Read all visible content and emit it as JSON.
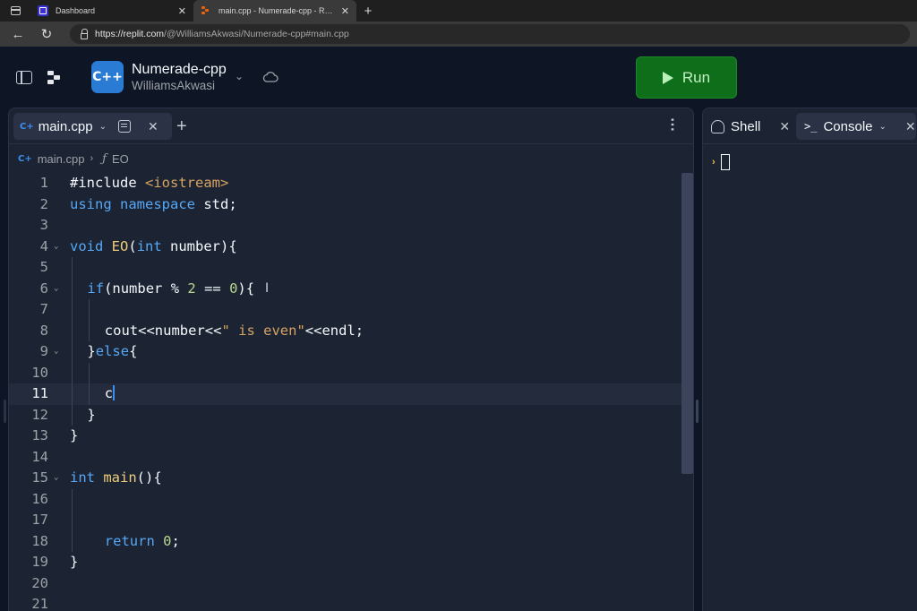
{
  "browser": {
    "tabs": [
      {
        "title": "Dashboard",
        "favicon": "dashboard-icon",
        "active": false
      },
      {
        "title": "main.cpp - Numerade-cpp - Replit",
        "favicon": "replit-icon",
        "active": true
      }
    ],
    "new_tab": "+",
    "url_host": "https://replit.com",
    "url_path": "/@WilliamsAkwasi/Numerade-cpp#main.cpp"
  },
  "header": {
    "project_name": "Numerade-cpp",
    "owner": "WilliamsAkwasi",
    "project_icon_text": "C++",
    "run_label": "Run",
    "run_color": "#0f6e1a"
  },
  "editor": {
    "tab_label": "main.cpp",
    "breadcrumb_file": "main.cpp",
    "breadcrumb_symbol": "EO",
    "breadcrumb_symbol_icon": "ƒ",
    "current_line": 11,
    "lines": [
      {
        "n": "1",
        "text": "#include <iostream>"
      },
      {
        "n": "2",
        "text": "using namespace std;"
      },
      {
        "n": "3",
        "text": ""
      },
      {
        "n": "4",
        "text": "void EO(int number){"
      },
      {
        "n": "5",
        "text": ""
      },
      {
        "n": "6",
        "text": "  if(number % 2 == 0){"
      },
      {
        "n": "7",
        "text": ""
      },
      {
        "n": "8",
        "text": "    cout<<number<<\" is even\"<<endl;"
      },
      {
        "n": "9",
        "text": "  }else{"
      },
      {
        "n": "10",
        "text": ""
      },
      {
        "n": "11",
        "text": "    c"
      },
      {
        "n": "12",
        "text": "  }"
      },
      {
        "n": "13",
        "text": "}"
      },
      {
        "n": "14",
        "text": ""
      },
      {
        "n": "15",
        "text": "int main(){"
      },
      {
        "n": "16",
        "text": ""
      },
      {
        "n": "17",
        "text": ""
      },
      {
        "n": "18",
        "text": "    return 0;"
      },
      {
        "n": "19",
        "text": "}"
      },
      {
        "n": "20",
        "text": ""
      },
      {
        "n": "21",
        "text": ""
      }
    ]
  },
  "tools": {
    "shell_label": "Shell",
    "console_label": "Console",
    "console_prompt": "›"
  }
}
